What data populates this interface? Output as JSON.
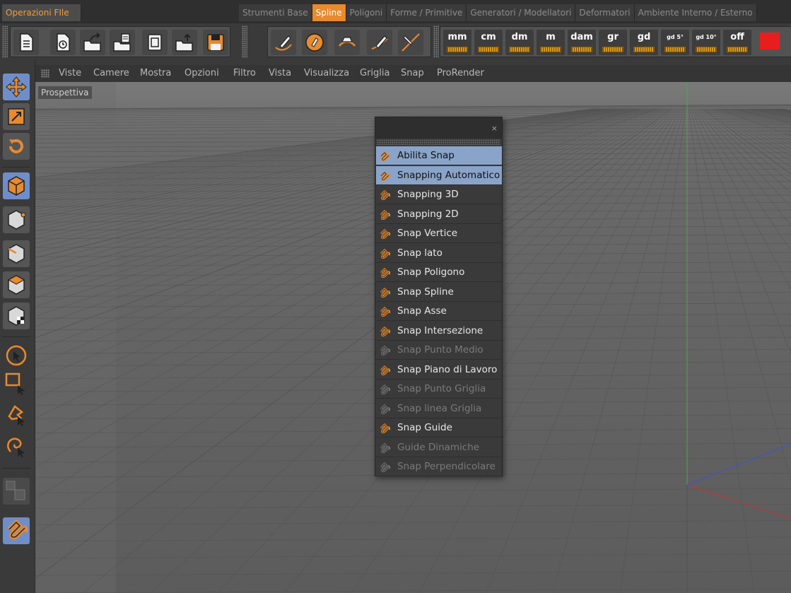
{
  "tabs": {
    "left": "Operazioni FIle",
    "right": [
      {
        "label": "Strumenti Base",
        "active": false
      },
      {
        "label": "Spline",
        "active": true
      },
      {
        "label": "Poligoni",
        "active": false
      },
      {
        "label": "Forme / Primitive",
        "active": false
      },
      {
        "label": "Generatori / Modellatori",
        "active": false
      },
      {
        "label": "Deformatori",
        "active": false
      },
      {
        "label": "Ambiente Interno / Esterno",
        "active": false
      }
    ]
  },
  "toolbar": {
    "file_icons": [
      "new-document-icon",
      "open-recent-icon",
      "import-icon",
      "export-icon",
      "document-icon",
      "open-icon",
      "save-icon"
    ],
    "spline_icons": [
      "pen-spline-icon",
      "spline-draw-icon",
      "spline-arc-icon",
      "spline-bezier-icon",
      "spline-line-icon"
    ],
    "units": [
      "mm",
      "cm",
      "dm",
      "m",
      "dam",
      "gr",
      "gd",
      "gd 5°",
      "gd 10°",
      "off"
    ],
    "accent_color": "#e81e1e"
  },
  "viewport_menu": [
    "Viste",
    "Camere",
    "Mostra",
    "Opzioni",
    "Filtro",
    "Vista",
    "Visualizza",
    "Griglia",
    "Snap",
    "ProRender"
  ],
  "viewport": {
    "label": "Prospettiva"
  },
  "snap_popup": {
    "close": "×",
    "items": [
      {
        "label": "Abilita Snap",
        "state": "highlighted",
        "icon": "magnet-icon"
      },
      {
        "label": "Snapping Automatico",
        "state": "highlighted",
        "icon": "auto-snap-icon"
      },
      {
        "label": "Snapping 3D",
        "state": "normal",
        "icon": "snap-3d-icon"
      },
      {
        "label": "Snapping 2D",
        "state": "normal",
        "icon": "snap-2d-icon"
      },
      {
        "label": "Snap Vertice",
        "state": "normal",
        "icon": "snap-vertex-icon"
      },
      {
        "label": "Snap lato",
        "state": "normal",
        "icon": "snap-edge-icon"
      },
      {
        "label": "Snap Poligono",
        "state": "normal",
        "icon": "snap-polygon-icon"
      },
      {
        "label": "Snap Spline",
        "state": "normal",
        "icon": "snap-spline-icon"
      },
      {
        "label": "Snap Asse",
        "state": "normal",
        "icon": "snap-axis-icon"
      },
      {
        "label": "Snap Intersezione",
        "state": "normal",
        "icon": "snap-intersection-icon"
      },
      {
        "label": "Snap Punto Medio",
        "state": "disabled",
        "icon": "snap-midpoint-icon"
      },
      {
        "label": "Snap Piano di Lavoro",
        "state": "normal",
        "icon": "snap-workplane-icon"
      },
      {
        "label": "Snap Punto Griglia",
        "state": "disabled",
        "icon": "snap-grid-point-icon"
      },
      {
        "label": "Snap linea Griglia",
        "state": "disabled",
        "icon": "snap-grid-line-icon"
      },
      {
        "label": "Snap Guide",
        "state": "normal",
        "icon": "snap-guide-icon"
      },
      {
        "label": "Guide Dinamiche",
        "state": "disabled",
        "icon": "dynamic-guides-icon"
      },
      {
        "label": "Snap Perpendicolare",
        "state": "disabled",
        "icon": "snap-perpendicular-icon"
      }
    ]
  },
  "left_tools": [
    "move-icon",
    "scale-icon",
    "rotate-icon",
    "model-mode-icon",
    "point-mode-icon",
    "edge-mode-icon",
    "polygon-mode-icon",
    "texture-mode-icon",
    "live-selection-icon",
    "rect-selection-icon",
    "lasso-selection-icon",
    "polygon-selection-icon",
    "workplane-icon",
    "snap-magnet-icon"
  ]
}
